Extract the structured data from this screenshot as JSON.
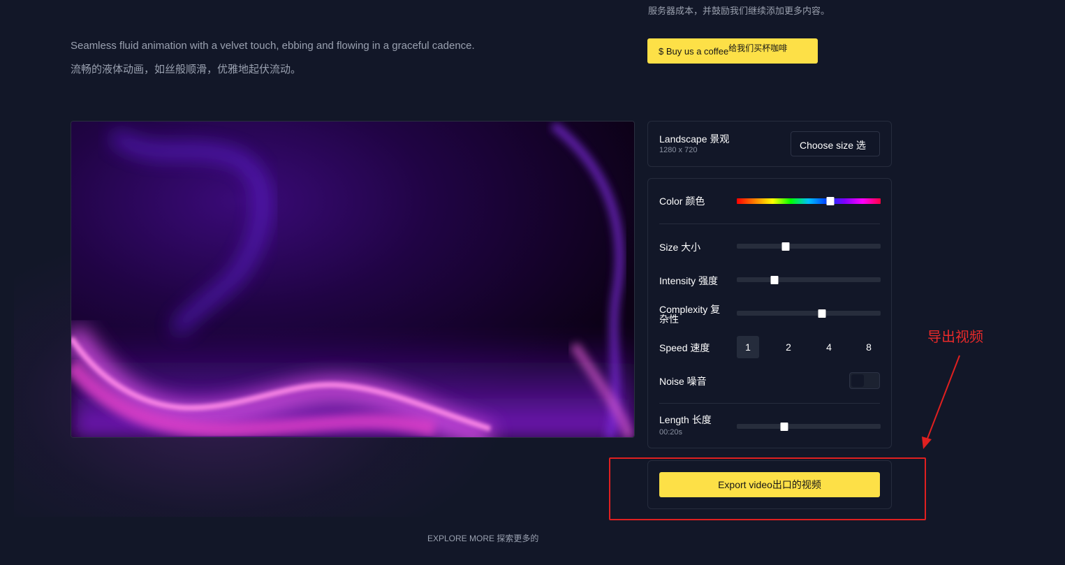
{
  "header": {
    "top_note": "服务器成本，并鼓励我们继续添加更多内容。",
    "description_en": "Seamless fluid animation with a velvet touch, ebbing and flowing in a graceful cadence.",
    "description_zh": "流畅的液体动画，如丝般顺滑，优雅地起伏流动。",
    "coffee_button": {
      "label": "$ Buy us a coffee",
      "label_zh": "给我们买杯咖啡"
    }
  },
  "size_panel": {
    "title": "Landscape 景观",
    "resolution": "1280 x 720",
    "select_label": "Choose size 选"
  },
  "controls": {
    "color": {
      "label": "Color 颜色",
      "hue_fraction": 0.65
    },
    "size": {
      "label": "Size 大小",
      "value_fraction": 0.34
    },
    "intensity": {
      "label": "Intensity 强度",
      "value_fraction": 0.26
    },
    "complexity": {
      "label_line1": "Complexity 复",
      "label_line2": "杂性",
      "value_fraction": 0.59
    },
    "speed": {
      "label": "Speed 速度",
      "options": [
        "1",
        "2",
        "4",
        "8"
      ],
      "selected": "1"
    },
    "noise": {
      "label": "Noise 噪音",
      "enabled": false
    },
    "length": {
      "label": "Length 长度",
      "value": "00:20s",
      "value_fraction": 0.33
    }
  },
  "export": {
    "label": "Export video出口的视频"
  },
  "footer": {
    "explore": "EXPLORE MORE 探索更多的"
  },
  "annotation": {
    "text": "导出视频",
    "color": "#e02020"
  },
  "colors": {
    "background": "#121728",
    "accent": "#fde047",
    "panel_border": "#262c3d"
  }
}
